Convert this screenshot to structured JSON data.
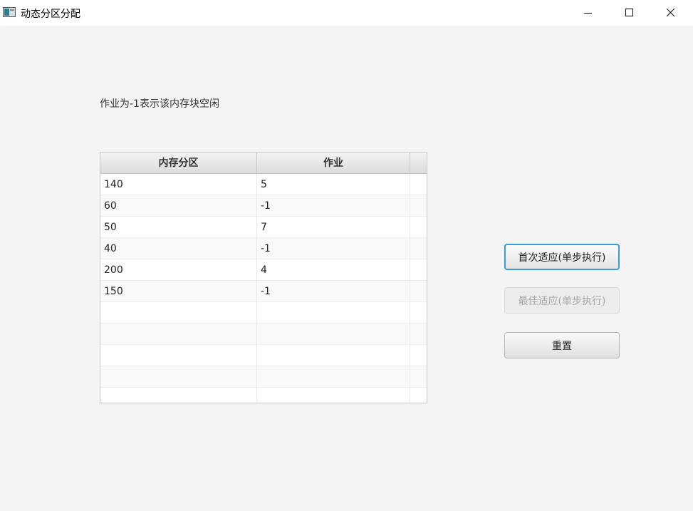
{
  "window": {
    "title": "动态分区分配"
  },
  "hint": "作业为-1表示该内存块空闲",
  "table": {
    "columns": [
      "内存分区",
      "作业"
    ],
    "rows": [
      [
        "140",
        "5"
      ],
      [
        "60",
        "-1"
      ],
      [
        "50",
        "7"
      ],
      [
        "40",
        "-1"
      ],
      [
        "200",
        "4"
      ],
      [
        "150",
        "-1"
      ],
      [
        "",
        ""
      ],
      [
        "",
        ""
      ],
      [
        "",
        ""
      ],
      [
        "",
        ""
      ],
      [
        "",
        ""
      ]
    ]
  },
  "buttons": {
    "first_fit": "首次适应(单步执行)",
    "best_fit": "最佳适应(单步执行)",
    "reset": "重置"
  }
}
